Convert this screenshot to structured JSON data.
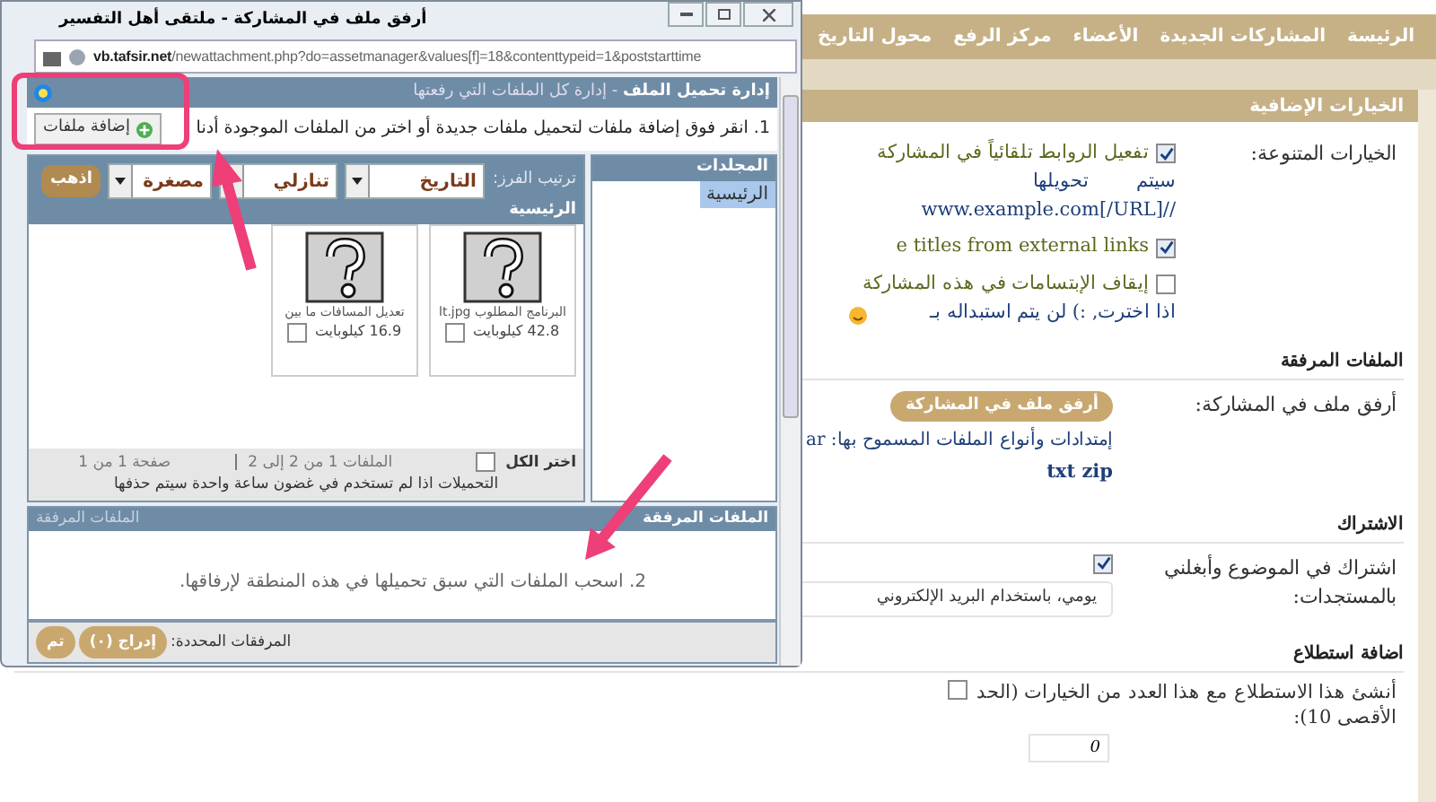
{
  "popup": {
    "title": "أرفق ملف في المشاركة - ملتقى أهل التفسير",
    "url_host": "vb.tafsir.net",
    "url_path": "/newattachment.php?do=assetmanager&values[f]=18&contenttypeid=1&poststarttime",
    "header": {
      "title": "إدارة تحميل الملف",
      "subtitle": "- إدارة كل الملفات التي رفعتها"
    },
    "instruction": "1. انقر فوق إضافة ملفات لتحميل ملفات جديدة أو اختر من الملفات الموجودة أدنا",
    "add_button": "إضافة ملفات",
    "sort": {
      "label": "ترتيب الفرز:",
      "selects": [
        "التاريخ",
        "تنازلي",
        "مصغرة"
      ],
      "go_button": "اذهب"
    },
    "folder_title": "الرئيسية",
    "folders": {
      "heading": "المجلدات",
      "items": [
        {
          "label": "الرئيسية",
          "selected": true
        }
      ]
    },
    "files": [
      {
        "name": "البرنامج المطلوب lt.jpg",
        "size": "42.8 كيلوبايت",
        "checked": false
      },
      {
        "name": "تعديل المسافات ما بين",
        "size": "16.9 كيلوبايت",
        "checked": false
      }
    ],
    "select_all": {
      "label": "اختر الكل",
      "checked": false
    },
    "file_count": "الملفات 1 من 2 إلى 2",
    "page_count": "صفحة 1 من 1",
    "notice": "التحميلات اذا لم تستخدم في غضون ساعة واحدة سيتم حذفها",
    "attached": {
      "heading": "الملفات المرفقة",
      "heading_left": "الملفات المرفقة",
      "hint": "2. اسحب الملفات التي سبق تحميلها في هذه المنطقة لإرفاقها.",
      "selected_label": "المرفقات المحددة:",
      "insert_button": "إدراج (٠)",
      "done_button": "تم"
    }
  },
  "page": {
    "nav": [
      "الرئيسة",
      "المشاركات الجديدة",
      "الأعضاء",
      "مركز الرفع",
      "محول التاريخ"
    ],
    "section_title": "الخيارات الإضافية",
    "misc": {
      "label": "الخيارات المتنوعة:",
      "options": [
        {
          "label": "تفعيل الروابط تلقائياً في المشاركة",
          "checked": true,
          "notes": [
            "سيتم        تحويلها",
            "//www.example.com[/URL]"
          ],
          "smiley": false
        },
        {
          "label": "e titles from external links",
          "checked": true,
          "smiley": false
        },
        {
          "label": "إيقاف الإبتسامات في هذه المشاركة",
          "checked": false,
          "notes": [
            "اذا اخترت, :) لن يتم استبداله بـ"
          ],
          "smiley": true
        }
      ]
    },
    "attachments": {
      "heading": "الملفات المرفقة",
      "label": "أرفق ملف في المشاركة:",
      "button": "أرفق ملف في المشاركة",
      "extensions": "إمتدادات وأنواع الملفات المسموح بها: ar",
      "extensions_2": "txt zip"
    },
    "subscription": {
      "heading": "الاشتراك",
      "label": "اشتراك في الموضوع وأبغلني بالمستجدات:",
      "checked": true,
      "mode": "يومي، باستخدام البريد الإلكتروني"
    },
    "poll": {
      "heading": "اضافة استطلاع",
      "label": "أنشئ هذا الاستطلاع مع هذا العدد من الخيارات (الحد الأقصى 10):",
      "checked": false,
      "value": "0"
    }
  }
}
